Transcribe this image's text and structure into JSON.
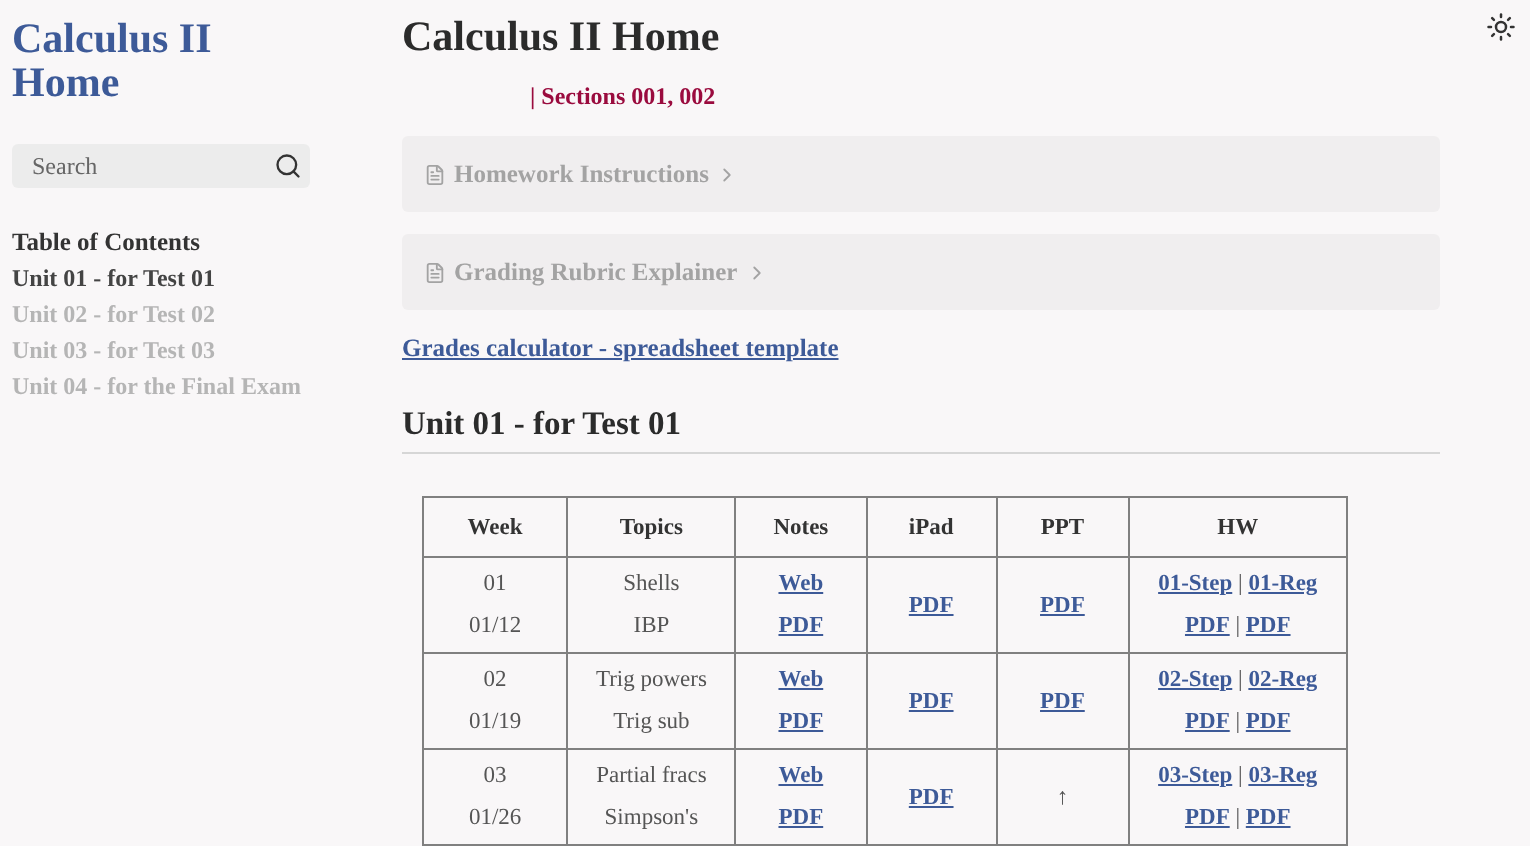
{
  "sidebar": {
    "title": "Calculus II Home",
    "search": {
      "placeholder": "Search"
    },
    "toc_heading": "Table of Contents",
    "items": [
      {
        "label": "Unit 01 - for Test 01",
        "selected": true
      },
      {
        "label": "Unit 02 - for Test 02",
        "selected": false
      },
      {
        "label": "Unit 03 - for Test 03",
        "selected": false
      },
      {
        "label": "Unit 04 - for the Final Exam",
        "selected": false
      }
    ]
  },
  "page": {
    "title": "Calculus II Home",
    "sections": "| Sections 001, 002",
    "panels": [
      {
        "label": "Homework Instructions",
        "expanded": false
      },
      {
        "label": "Grading Rubric Explainer",
        "expanded": false
      }
    ],
    "link": "Grades calculator - spreadsheet template",
    "unit_heading": "Unit 01 - for Test 01",
    "table": {
      "columns": [
        "Week",
        "Topics",
        "Notes",
        "iPad",
        "PPT",
        "HW"
      ],
      "rows": [
        {
          "week": [
            "01",
            "01/12"
          ],
          "topics": [
            "Shells",
            "IBP"
          ],
          "notes": [
            "Web",
            "PDF"
          ],
          "ipad": {
            "kind": "link",
            "text": "PDF"
          },
          "ppt": {
            "kind": "link",
            "text": "PDF"
          },
          "hw": [
            [
              {
                "kind": "link",
                "text": "01-Step"
              },
              {
                "kind": "text",
                "text": "|"
              },
              {
                "kind": "link",
                "text": "01-Reg"
              }
            ],
            [
              {
                "kind": "link",
                "text": "PDF"
              },
              {
                "kind": "text",
                "text": "|"
              },
              {
                "kind": "link",
                "text": "PDF"
              }
            ]
          ]
        },
        {
          "week": [
            "02",
            "01/19"
          ],
          "topics": [
            "Trig powers",
            "Trig sub"
          ],
          "notes": [
            "Web",
            "PDF"
          ],
          "ipad": {
            "kind": "link",
            "text": "PDF"
          },
          "ppt": {
            "kind": "link",
            "text": "PDF"
          },
          "hw": [
            [
              {
                "kind": "link",
                "text": "02-Step"
              },
              {
                "kind": "text",
                "text": "|"
              },
              {
                "kind": "link",
                "text": "02-Reg"
              }
            ],
            [
              {
                "kind": "link",
                "text": "PDF"
              },
              {
                "kind": "text",
                "text": "|"
              },
              {
                "kind": "link",
                "text": "PDF"
              }
            ]
          ]
        },
        {
          "week": [
            "03",
            "01/26"
          ],
          "topics": [
            "Partial fracs",
            "Simpson's"
          ],
          "notes": [
            "Web",
            "PDF"
          ],
          "ipad": {
            "kind": "link",
            "text": "PDF"
          },
          "ppt": {
            "kind": "text",
            "text": "↑"
          },
          "hw": [
            [
              {
                "kind": "link",
                "text": "03-Step"
              },
              {
                "kind": "text",
                "text": "|"
              },
              {
                "kind": "link",
                "text": "03-Reg"
              }
            ],
            [
              {
                "kind": "link",
                "text": "PDF"
              },
              {
                "kind": "text",
                "text": "|"
              },
              {
                "kind": "link",
                "text": "PDF"
              }
            ]
          ]
        }
      ]
    }
  }
}
